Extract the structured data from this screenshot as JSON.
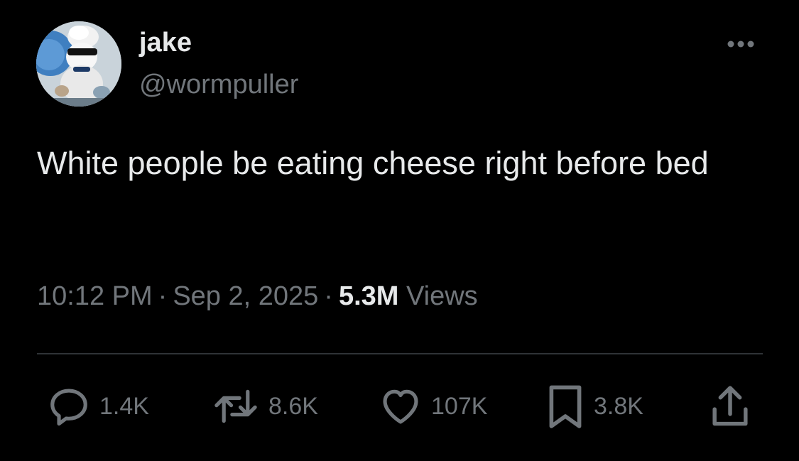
{
  "tweet": {
    "author": {
      "display_name": "jake",
      "handle": "@wormpuller",
      "avatar_icon": "avatar-image"
    },
    "text": "White people be eating cheese right before bed",
    "time": "10:12 PM",
    "date": "Sep 2, 2025",
    "separator": "·",
    "views_count": "5.3M",
    "views_label": "Views"
  },
  "actions": {
    "reply": {
      "icon": "reply-icon",
      "count": "1.4K"
    },
    "repost": {
      "icon": "repost-icon",
      "count": "8.6K"
    },
    "like": {
      "icon": "heart-icon",
      "count": "107K"
    },
    "bookmark": {
      "icon": "bookmark-icon",
      "count": "3.8K"
    },
    "share": {
      "icon": "share-icon"
    }
  },
  "more": {
    "icon": "more-icon"
  },
  "colors": {
    "background": "#000000",
    "primary_text": "#e7e9ea",
    "secondary_text": "#71767b",
    "divider": "#2f3336"
  }
}
